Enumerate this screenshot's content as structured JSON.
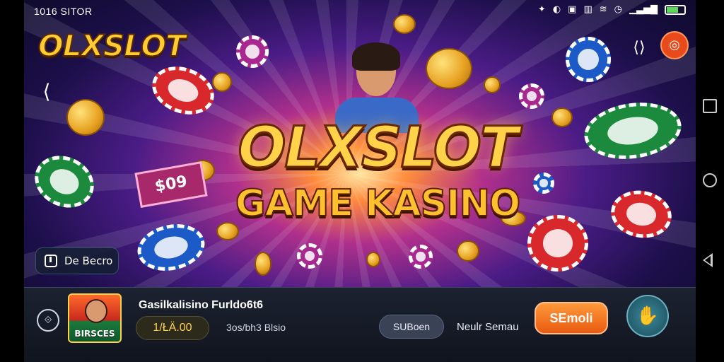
{
  "status_bar": {
    "time": "1016 SITOR",
    "battery_level": 0.6,
    "colors": {
      "battery": "#5cd65c"
    }
  },
  "header": {
    "logo_text": "OLXSLOT",
    "back_icon": "back-icon",
    "share_icon": "share-icon",
    "profile_icon": "profile-icon"
  },
  "hero": {
    "title": "OLXSLOT",
    "subtitle": "GAME KASINO",
    "ticket_text": "$09"
  },
  "demo_button": {
    "label": "De Becro"
  },
  "bottom_panel": {
    "game_thumb_label": "BIRSCES",
    "game_title": "Gasilkalisino Furldo6t6",
    "balance": "1/ŁÄ.00",
    "balance_label": "3os/bh3 Blsio",
    "pill_button": "SUBoen",
    "link_text": "Neulr Semau",
    "cta_button": "SEmoli"
  },
  "theme": {
    "accent": "#ffd24a",
    "cta": "#e85a10",
    "panel_bg": "#1c2230"
  }
}
